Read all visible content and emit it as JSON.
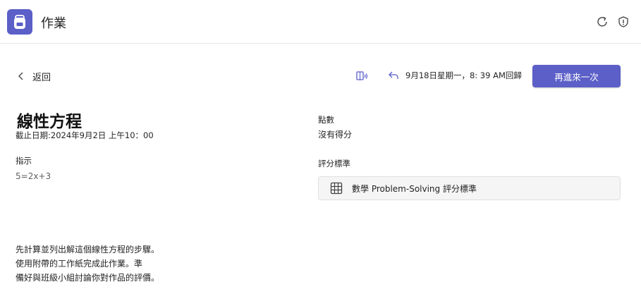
{
  "app": {
    "title": "作業",
    "icon": "backpack-icon",
    "accent": "#5b5fc7"
  },
  "toolbar": {
    "refresh_icon": "refresh-icon",
    "shield_icon": "shield-icon"
  },
  "nav": {
    "back_label": "返回"
  },
  "actions": {
    "reader_icon": "immersive-reader-icon",
    "returned_text": "9月18日星期一，8: 39 AM回歸",
    "resubmit_label": "再進來一次"
  },
  "assignment": {
    "title": "線性方程",
    "due": "截止日期:2024年9月2日 上午10：00",
    "instructions_label": "指示",
    "instructions_value": "5=2x+3",
    "points_label": "點數",
    "points_value": "沒有得分",
    "rubric_label": "評分標準",
    "rubric_name": "數學 Problem-Solving 評分標準",
    "description": [
      "先計算並列出解這個線性方程的步驟。",
      "使用附帶的工作紙完成此作業。準",
      "備好與班級小組討論你對作品的評價。"
    ]
  }
}
